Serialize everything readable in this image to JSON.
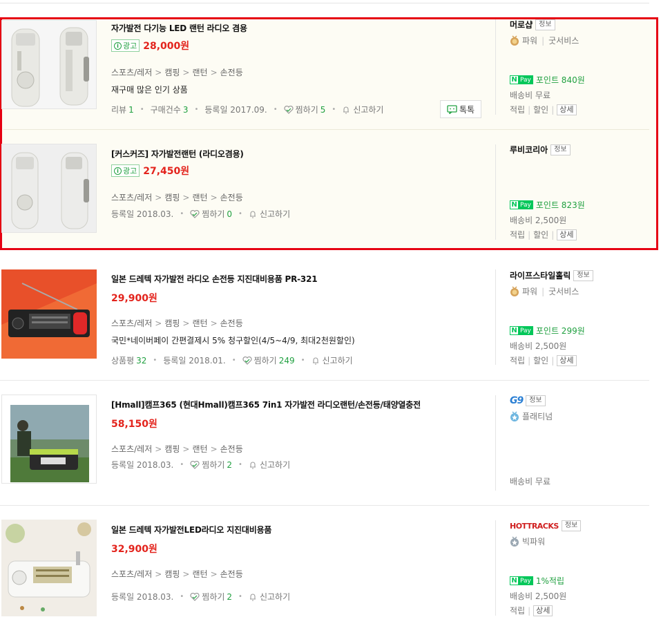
{
  "products": [
    {
      "title": "자가발전 다기능 LED 랜턴 라디오 겸용",
      "ad_label": "광고",
      "price": "28,000원",
      "category": [
        "스포츠/레저",
        "캠핑",
        "랜턴",
        "손전등"
      ],
      "description": "재구매 많은 인기 상품",
      "meta": {
        "review_label": "리뷰",
        "review_count": "1",
        "purchase_label": "구매건수",
        "purchase_count": "3",
        "registered": "등록일 2017.09.",
        "like_label": "찜하기",
        "like_count": "5",
        "report_label": "신고하기"
      },
      "talk_label": "톡톡",
      "mall": {
        "name": "머로샵",
        "info": "정보",
        "grade": "파워",
        "service": "굿서비스",
        "npay": "포인트 840원",
        "shipping": "배송비 무료",
        "extras": [
          "적립",
          "할인"
        ],
        "detail": "상세"
      }
    },
    {
      "title": "[커스커즈] 자가발전랜턴 (라디오겸용)",
      "ad_label": "광고",
      "price": "27,450원",
      "category": [
        "스포츠/레저",
        "캠핑",
        "랜턴",
        "손전등"
      ],
      "meta": {
        "registered": "등록일 2018.03.",
        "like_label": "찜하기",
        "like_count": "0",
        "report_label": "신고하기"
      },
      "mall": {
        "name": "루비코리아",
        "info": "정보",
        "npay": "포인트 823원",
        "shipping": "배송비 2,500원",
        "extras": [
          "적립",
          "할인"
        ],
        "detail": "상세"
      }
    },
    {
      "title": "일본 드레텍 자가발전 라디오 손전등 지진대비용품 PR-321",
      "price": "29,900원",
      "category": [
        "스포츠/레저",
        "캠핑",
        "랜턴",
        "손전등"
      ],
      "description": "국민*네이버페이 간편결제시 5% 청구할인(4/5~4/9, 최대2천원할인)",
      "meta": {
        "rating_label": "상품평",
        "rating_count": "32",
        "registered": "등록일 2018.01.",
        "like_label": "찜하기",
        "like_count": "249",
        "report_label": "신고하기"
      },
      "mall": {
        "name": "라이프스타일홀릭",
        "info": "정보",
        "grade": "파워",
        "service": "굿서비스",
        "npay": "포인트 299원",
        "shipping": "배송비 2,500원",
        "extras": [
          "적립",
          "할인"
        ],
        "detail": "상세"
      }
    },
    {
      "title": "[Hmall]캠프365 (현대Hmall)캠프365 7in1 자가발전 라디오랜턴/손전등/태양열충전",
      "price": "58,150원",
      "category": [
        "스포츠/레저",
        "캠핑",
        "랜턴",
        "손전등"
      ],
      "meta": {
        "registered": "등록일 2018.03.",
        "like_label": "찜하기",
        "like_count": "2",
        "report_label": "신고하기"
      },
      "mall": {
        "name": "G9",
        "info": "정보",
        "grade": "플래티넘",
        "shipping": "배송비 무료"
      }
    },
    {
      "title": "일본 드레텍 자가발전LED라디오 지진대비용품",
      "price": "32,900원",
      "category": [
        "스포츠/레저",
        "캠핑",
        "랜턴",
        "손전등"
      ],
      "meta": {
        "registered": "등록일 2018.03.",
        "like_label": "찜하기",
        "like_count": "2",
        "report_label": "신고하기"
      },
      "mall": {
        "name": "HOTTRACKS",
        "info": "정보",
        "grade": "빅파워",
        "npay": "1%적립",
        "shipping": "배송비 2,500원",
        "extras": [
          "적립"
        ],
        "detail": "상세"
      }
    }
  ],
  "colors": {
    "price": "#e3231c",
    "count_green": "#20a040",
    "ad_highlight_border": "#e60012",
    "ad_zone_bg": "#fdfcf4",
    "npay_green": "#03c75a"
  },
  "icons": [
    "info-circle-icon",
    "heart-icon",
    "bell-icon",
    "talk-bubble-icon",
    "medal-icon",
    "npay-icon"
  ]
}
